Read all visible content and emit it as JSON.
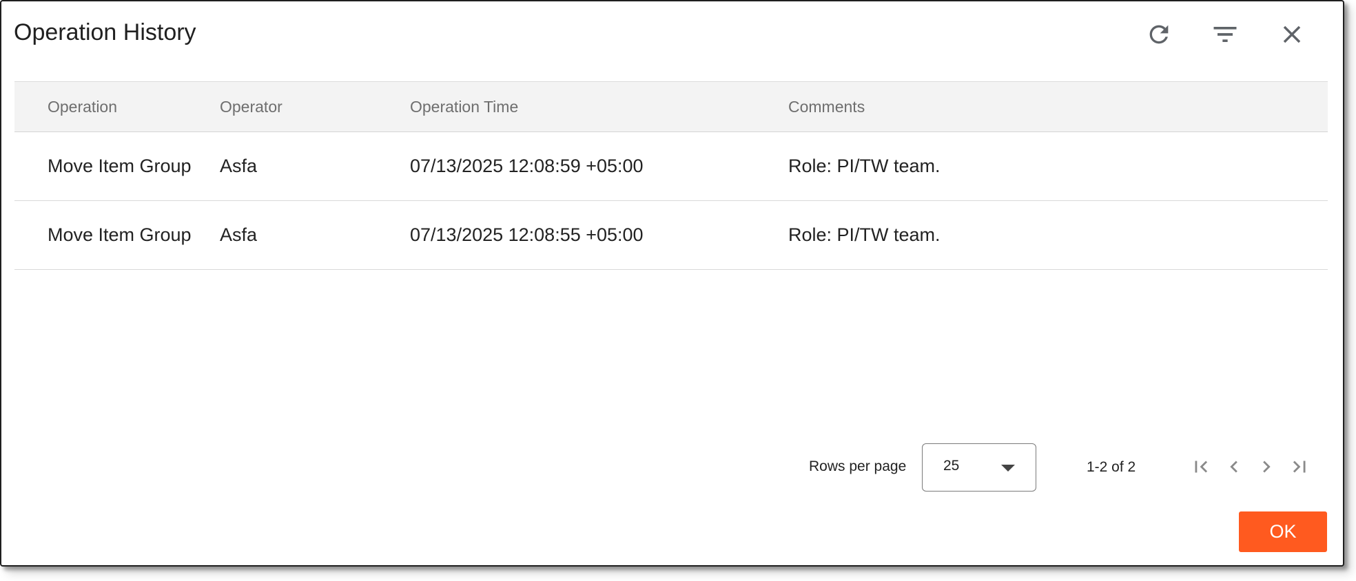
{
  "dialog": {
    "title": "Operation History"
  },
  "toolbar": {
    "icons": [
      "refresh-icon",
      "filter-icon",
      "close-icon"
    ]
  },
  "table": {
    "columns": [
      "Operation",
      "Operator",
      "Operation Time",
      "Comments"
    ],
    "rows": [
      {
        "operation": "Move Item Group",
        "operator": "Asfa",
        "time": "07/13/2025 12:08:59 +05:00",
        "comments": "Role: PI/TW team."
      },
      {
        "operation": "Move Item Group",
        "operator": "Asfa",
        "time": "07/13/2025 12:08:55 +05:00",
        "comments": "Role: PI/TW team."
      }
    ]
  },
  "pagination": {
    "rows_per_page_label": "Rows per page",
    "rows_per_page_value": "25",
    "range_text": "1-2 of 2",
    "icons": [
      "first-page-icon",
      "previous-page-icon",
      "next-page-icon",
      "last-page-icon"
    ]
  },
  "footer": {
    "ok_label": "OK"
  },
  "colors": {
    "accent": "#ff5a1f",
    "header_bg": "#f3f3f3",
    "icon": "#5f6368"
  }
}
